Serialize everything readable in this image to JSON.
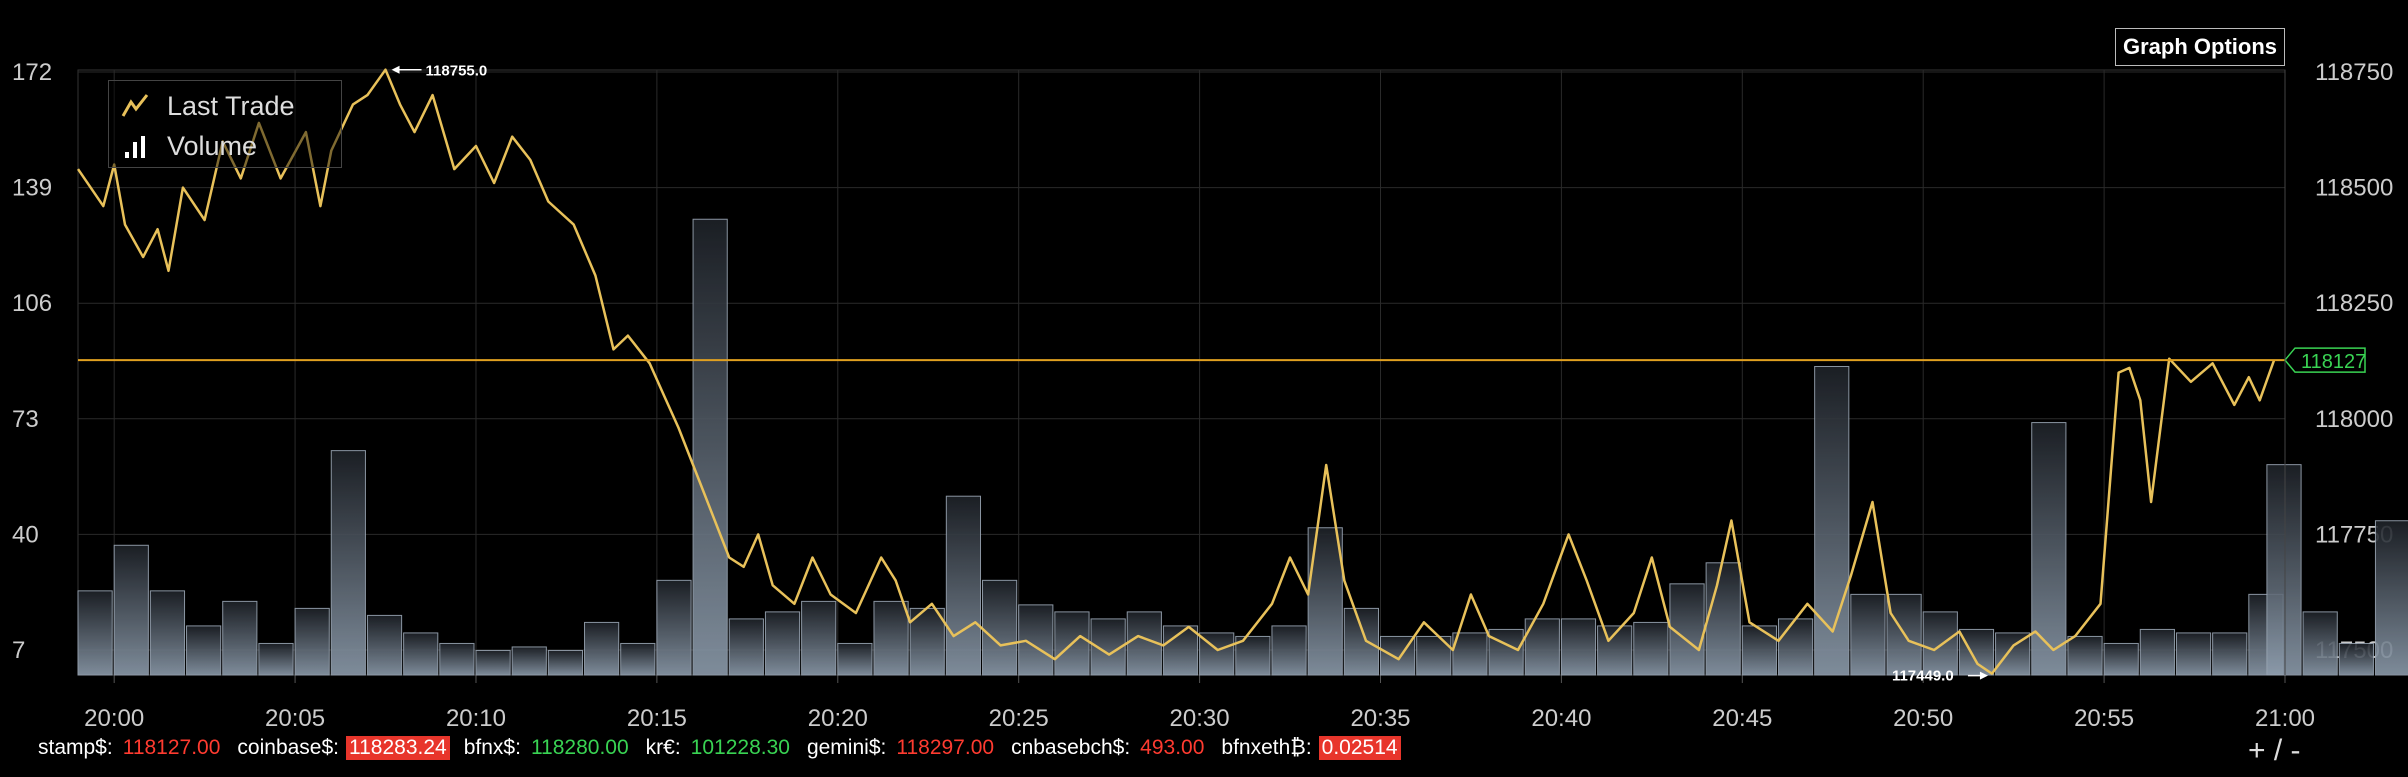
{
  "header": {
    "graph_options_label": "Graph Options"
  },
  "legend": {
    "items": [
      "Last Trade",
      "Volume"
    ]
  },
  "footer": {
    "tickers": [
      {
        "label": "stamp$:",
        "value": "118127.00",
        "style": "down"
      },
      {
        "label": "coinbase$:",
        "value": "118283.24",
        "style": "boxed"
      },
      {
        "label": "bfnx$:",
        "value": "118280.00",
        "style": "up"
      },
      {
        "label": "kr€:",
        "value": "101228.30",
        "style": "up"
      },
      {
        "label": "gemini$:",
        "value": "118297.00",
        "style": "down"
      },
      {
        "label": "cnbasebch$:",
        "value": "493.00",
        "style": "down"
      },
      {
        "label": "bfnxeth₿:",
        "value": "0.02514",
        "style": "boxed"
      }
    ],
    "zoom_label": "+ / -"
  },
  "colors": {
    "price": "#e8c15a",
    "volume": "#8a9aac",
    "current_line": "#e0a020",
    "grid": "#2a2a2a",
    "up": "#39d353",
    "down": "#ff3b30"
  },
  "chart_data": {
    "type": "line",
    "x_ticks": [
      "20:00",
      "20:05",
      "20:10",
      "20:15",
      "20:20",
      "20:25",
      "20:30",
      "20:35",
      "20:40",
      "20:45",
      "20:50",
      "20:55",
      "21:00"
    ],
    "xlim_minutes": [
      -1,
      60
    ],
    "y_left_ticks": [
      "7",
      "40",
      "73",
      "106",
      "139",
      "172"
    ],
    "y_left_range": [
      7,
      172
    ],
    "y_right_ticks": [
      "117500",
      "117750",
      "118000",
      "118250",
      "118500",
      "118750"
    ],
    "y_right_range": [
      117500,
      118750
    ],
    "current_price": 118127,
    "current_price_label": "118127",
    "high_label": "118755.0",
    "high": {
      "minute": 7.5,
      "value": 118755
    },
    "low_label": "117449.0",
    "low": {
      "minute": 51.9,
      "value": 117449
    },
    "grid": true,
    "legend_position": "top-left",
    "series": [
      {
        "name": "Last Trade",
        "type": "line",
        "points": [
          [
            -1,
            118540
          ],
          [
            -0.3,
            118460
          ],
          [
            0,
            118550
          ],
          [
            0.3,
            118420
          ],
          [
            0.8,
            118350
          ],
          [
            1.2,
            118410
          ],
          [
            1.5,
            118320
          ],
          [
            1.9,
            118500
          ],
          [
            2.5,
            118430
          ],
          [
            3,
            118600
          ],
          [
            3.5,
            118520
          ],
          [
            4,
            118640
          ],
          [
            4.6,
            118520
          ],
          [
            5.3,
            118620
          ],
          [
            5.7,
            118460
          ],
          [
            6,
            118580
          ],
          [
            6.6,
            118680
          ],
          [
            7,
            118700
          ],
          [
            7.5,
            118755
          ],
          [
            7.9,
            118680
          ],
          [
            8.3,
            118620
          ],
          [
            8.8,
            118700
          ],
          [
            9.4,
            118540
          ],
          [
            10,
            118590
          ],
          [
            10.5,
            118510
          ],
          [
            11,
            118610
          ],
          [
            11.5,
            118560
          ],
          [
            12,
            118470
          ],
          [
            12.7,
            118420
          ],
          [
            13.3,
            118310
          ],
          [
            13.8,
            118150
          ],
          [
            14.2,
            118180
          ],
          [
            14.8,
            118120
          ],
          [
            15.2,
            118050
          ],
          [
            15.6,
            117980
          ],
          [
            16,
            117900
          ],
          [
            16.5,
            117800
          ],
          [
            17,
            117700
          ],
          [
            17.4,
            117680
          ],
          [
            17.8,
            117750
          ],
          [
            18.2,
            117640
          ],
          [
            18.8,
            117600
          ],
          [
            19.3,
            117700
          ],
          [
            19.8,
            117620
          ],
          [
            20.5,
            117580
          ],
          [
            21.2,
            117700
          ],
          [
            21.6,
            117650
          ],
          [
            22,
            117560
          ],
          [
            22.6,
            117600
          ],
          [
            23.2,
            117530
          ],
          [
            23.8,
            117560
          ],
          [
            24.5,
            117510
          ],
          [
            25.2,
            117520
          ],
          [
            26,
            117480
          ],
          [
            26.7,
            117530
          ],
          [
            27.5,
            117490
          ],
          [
            28.3,
            117530
          ],
          [
            29,
            117510
          ],
          [
            29.7,
            117550
          ],
          [
            30.5,
            117500
          ],
          [
            31.2,
            117520
          ],
          [
            32,
            117600
          ],
          [
            32.5,
            117700
          ],
          [
            33,
            117620
          ],
          [
            33.5,
            117900
          ],
          [
            34,
            117650
          ],
          [
            34.6,
            117520
          ],
          [
            35.5,
            117480
          ],
          [
            36.2,
            117560
          ],
          [
            37,
            117500
          ],
          [
            37.5,
            117620
          ],
          [
            38,
            117530
          ],
          [
            38.8,
            117500
          ],
          [
            39.5,
            117600
          ],
          [
            40.2,
            117750
          ],
          [
            40.7,
            117650
          ],
          [
            41.3,
            117520
          ],
          [
            42,
            117580
          ],
          [
            42.5,
            117700
          ],
          [
            43,
            117550
          ],
          [
            43.8,
            117500
          ],
          [
            44.3,
            117640
          ],
          [
            44.7,
            117780
          ],
          [
            45.2,
            117560
          ],
          [
            46,
            117520
          ],
          [
            46.8,
            117600
          ],
          [
            47.5,
            117540
          ],
          [
            48,
            117660
          ],
          [
            48.6,
            117820
          ],
          [
            49.1,
            117580
          ],
          [
            49.6,
            117520
          ],
          [
            50.3,
            117500
          ],
          [
            51,
            117540
          ],
          [
            51.5,
            117470
          ],
          [
            51.9,
            117449
          ],
          [
            52.5,
            117510
          ],
          [
            53.1,
            117540
          ],
          [
            53.6,
            117500
          ],
          [
            54.2,
            117530
          ],
          [
            54.9,
            117600
          ],
          [
            55.4,
            118100
          ],
          [
            55.7,
            118110
          ],
          [
            56,
            118040
          ],
          [
            56.3,
            117820
          ],
          [
            56.8,
            118130
          ],
          [
            57.4,
            118080
          ],
          [
            58,
            118120
          ],
          [
            58.6,
            118030
          ],
          [
            59,
            118090
          ],
          [
            59.3,
            118040
          ],
          [
            59.7,
            118127
          ]
        ]
      },
      {
        "name": "Volume",
        "type": "bar",
        "bar_minutes": [
          -0.5,
          0.5,
          1.5,
          2.5,
          3.5,
          4.5,
          5.5,
          6.5,
          7.5,
          8.5,
          9.5,
          10.5,
          11.5,
          12.5,
          13.5,
          14.5,
          15.5,
          16.5,
          17.5,
          18.5,
          19.5,
          20.5,
          21.5,
          22.5,
          23.5,
          24.5,
          25.5,
          26.5,
          27.5,
          28.5,
          29.5,
          30.5,
          31.5,
          32.5,
          33.5,
          34.5,
          35.5,
          36.5,
          37.5,
          38.5,
          39.5,
          40.5,
          41.5,
          42.5,
          43.5,
          44.5,
          45.5,
          46.5,
          47.5,
          48.5,
          49.5,
          50.5,
          51.5,
          52.5,
          53.5,
          54.5,
          55.5,
          56.5,
          57.5,
          58.5,
          59.5
        ],
        "values": [
          24,
          37,
          24,
          14,
          21,
          9,
          19,
          64,
          17,
          12,
          9,
          7,
          8,
          7,
          15,
          9,
          27,
          130,
          16,
          18,
          21,
          9,
          21,
          19,
          51,
          27,
          20,
          18,
          16,
          18,
          14,
          12,
          11,
          14,
          42,
          19,
          11,
          11,
          12,
          13,
          16,
          16,
          14,
          15,
          26,
          32,
          14,
          16,
          88,
          23,
          23,
          18,
          13,
          12,
          72,
          11,
          9,
          13,
          12,
          12,
          23,
          60,
          18,
          9,
          44
        ]
      }
    ]
  }
}
